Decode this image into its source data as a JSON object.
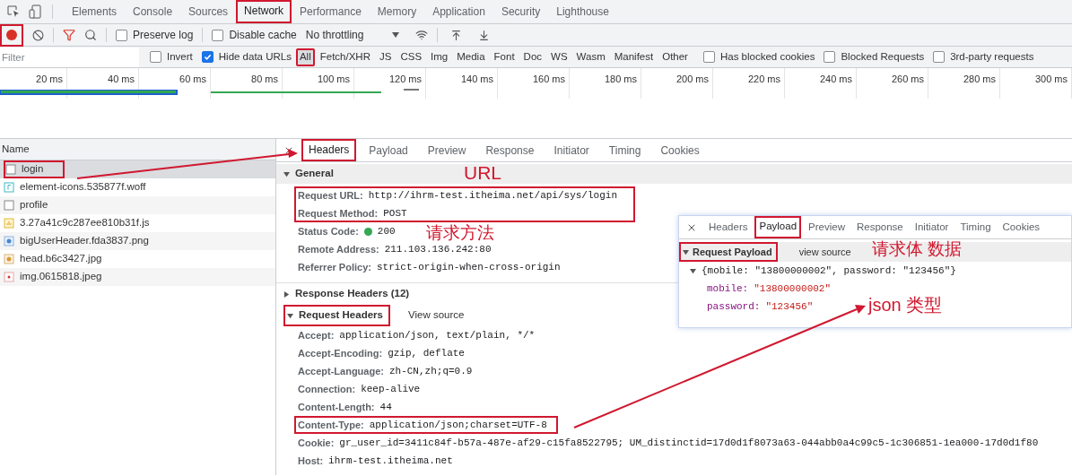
{
  "main_tabs": [
    {
      "label": "Elements",
      "selected": false,
      "boxed": false
    },
    {
      "label": "Console",
      "selected": false,
      "boxed": false
    },
    {
      "label": "Sources",
      "selected": false,
      "boxed": false
    },
    {
      "label": "Network",
      "selected": true,
      "boxed": true
    },
    {
      "label": "Performance",
      "selected": false,
      "boxed": false
    },
    {
      "label": "Memory",
      "selected": false,
      "boxed": false
    },
    {
      "label": "Application",
      "selected": false,
      "boxed": false
    },
    {
      "label": "Security",
      "selected": false,
      "boxed": false
    },
    {
      "label": "Lighthouse",
      "selected": false,
      "boxed": false
    }
  ],
  "toolbar": {
    "record_boxed": true,
    "preserve_log": {
      "label": "Preserve log",
      "checked": false
    },
    "disable_cache": {
      "label": "Disable cache",
      "checked": false
    },
    "throttling": {
      "value": "No throttling"
    }
  },
  "filter_bar": {
    "placeholder": "Filter",
    "checks": [
      {
        "label": "Invert",
        "checked": false
      },
      {
        "label": "Hide data URLs",
        "checked": true
      }
    ],
    "types": [
      {
        "label": "All",
        "selected": true,
        "boxed": true
      },
      {
        "label": "Fetch/XHR",
        "selected": false,
        "boxed": false
      },
      {
        "label": "JS",
        "selected": false,
        "boxed": false
      },
      {
        "label": "CSS",
        "selected": false,
        "boxed": false
      },
      {
        "label": "Img",
        "selected": false,
        "boxed": false
      },
      {
        "label": "Media",
        "selected": false,
        "boxed": false
      },
      {
        "label": "Font",
        "selected": false,
        "boxed": false
      },
      {
        "label": "Doc",
        "selected": false,
        "boxed": false
      },
      {
        "label": "WS",
        "selected": false,
        "boxed": false
      },
      {
        "label": "Wasm",
        "selected": false,
        "boxed": false
      },
      {
        "label": "Manifest",
        "selected": false,
        "boxed": false
      },
      {
        "label": "Other",
        "selected": false,
        "boxed": false
      }
    ],
    "extra_checks": [
      {
        "label": "Has blocked cookies",
        "checked": false
      },
      {
        "label": "Blocked Requests",
        "checked": false
      },
      {
        "label": "3rd-party requests",
        "checked": false
      }
    ]
  },
  "timeline": {
    "ticks": [
      "20 ms",
      "40 ms",
      "60 ms",
      "80 ms",
      "100 ms",
      "120 ms",
      "140 ms",
      "160 ms",
      "180 ms",
      "200 ms",
      "220 ms",
      "240 ms",
      "260 ms",
      "280 ms",
      "300 ms"
    ]
  },
  "requests": {
    "column": "Name",
    "rows": [
      {
        "name": "login",
        "kind": "document",
        "selected": true,
        "boxed": true
      },
      {
        "name": "element-icons.535877f.woff",
        "kind": "font",
        "selected": false,
        "boxed": false
      },
      {
        "name": "profile",
        "kind": "document",
        "selected": false,
        "boxed": false
      },
      {
        "name": "3.27a41c9c287ee810b31f.js",
        "kind": "script",
        "selected": false,
        "boxed": false
      },
      {
        "name": "bigUserHeader.fda3837.png",
        "kind": "png",
        "selected": false,
        "boxed": false
      },
      {
        "name": "head.b6c3427.jpg",
        "kind": "jpg",
        "selected": false,
        "boxed": false
      },
      {
        "name": "img.0615818.jpeg",
        "kind": "jpeg",
        "selected": false,
        "boxed": false
      }
    ]
  },
  "detail": {
    "tabs": [
      {
        "label": "Headers",
        "selected": true,
        "boxed": true
      },
      {
        "label": "Payload",
        "selected": false,
        "boxed": false
      },
      {
        "label": "Preview",
        "selected": false,
        "boxed": false
      },
      {
        "label": "Response",
        "selected": false,
        "boxed": false
      },
      {
        "label": "Initiator",
        "selected": false,
        "boxed": false
      },
      {
        "label": "Timing",
        "selected": false,
        "boxed": false
      },
      {
        "label": "Cookies",
        "selected": false,
        "boxed": false
      }
    ],
    "general": {
      "title": "General",
      "expanded": true,
      "rows": [
        {
          "label": "Request URL:",
          "value": "http://ihrm-test.itheima.net/api/sys/login",
          "kind": "plain",
          "boxed": true
        },
        {
          "label": "Request Method:",
          "value": "POST",
          "kind": "plain",
          "boxed": true
        },
        {
          "label": "Status Code:",
          "value": "200",
          "kind": "status",
          "boxed": false
        },
        {
          "label": "Remote Address:",
          "value": "211.103.136.242:80",
          "kind": "plain",
          "boxed": false
        },
        {
          "label": "Referrer Policy:",
          "value": "strict-origin-when-cross-origin",
          "kind": "plain",
          "boxed": false
        }
      ]
    },
    "response_headers": {
      "title": "Response Headers (12)",
      "expanded": false
    },
    "request_headers": {
      "title": "Request Headers",
      "expanded": true,
      "boxed": true,
      "link": "View source",
      "rows": [
        {
          "label": "Accept:",
          "value": "application/json, text/plain, */*",
          "boxed": false
        },
        {
          "label": "Accept-Encoding:",
          "value": "gzip, deflate",
          "boxed": false
        },
        {
          "label": "Accept-Language:",
          "value": "zh-CN,zh;q=0.9",
          "boxed": false
        },
        {
          "label": "Connection:",
          "value": "keep-alive",
          "boxed": false
        },
        {
          "label": "Content-Length:",
          "value": "44",
          "boxed": false
        },
        {
          "label": "Content-Type:",
          "value": "application/json;charset=UTF-8",
          "boxed": true
        },
        {
          "label": "Cookie:",
          "value": "gr_user_id=3411c84f-b57a-487e-af29-c15fa8522795; UM_distinctid=17d0d1f8073a63-044abb0a4c99c5-1c306851-1ea000-17d0d1f80",
          "boxed": false
        },
        {
          "label": "Host:",
          "value": "ihrm-test.itheima.net",
          "boxed": false
        }
      ]
    }
  },
  "payload_inset": {
    "tabs": [
      {
        "label": "Headers",
        "selected": false,
        "boxed": false
      },
      {
        "label": "Payload",
        "selected": true,
        "boxed": true
      },
      {
        "label": "Preview",
        "selected": false,
        "boxed": false
      },
      {
        "label": "Response",
        "selected": false,
        "boxed": false
      },
      {
        "label": "Initiator",
        "selected": false,
        "boxed": false
      },
      {
        "label": "Timing",
        "selected": false,
        "boxed": false
      },
      {
        "label": "Cookies",
        "selected": false,
        "boxed": false
      }
    ],
    "section": {
      "title": "Request Payload",
      "boxed": true,
      "expanded": true,
      "link": "view source"
    },
    "summary": {
      "text": "{mobile: \"13800000002\", password: \"123456\"}",
      "expanded": true
    },
    "properties": [
      {
        "key": "mobile:",
        "value": "\"13800000002\""
      },
      {
        "key": "password:",
        "value": "\"123456\""
      }
    ]
  },
  "annotations": [
    {
      "text": "URL"
    },
    {
      "text": "请求方法"
    },
    {
      "text": "请求体 数据"
    },
    {
      "text": "json 类型"
    }
  ]
}
